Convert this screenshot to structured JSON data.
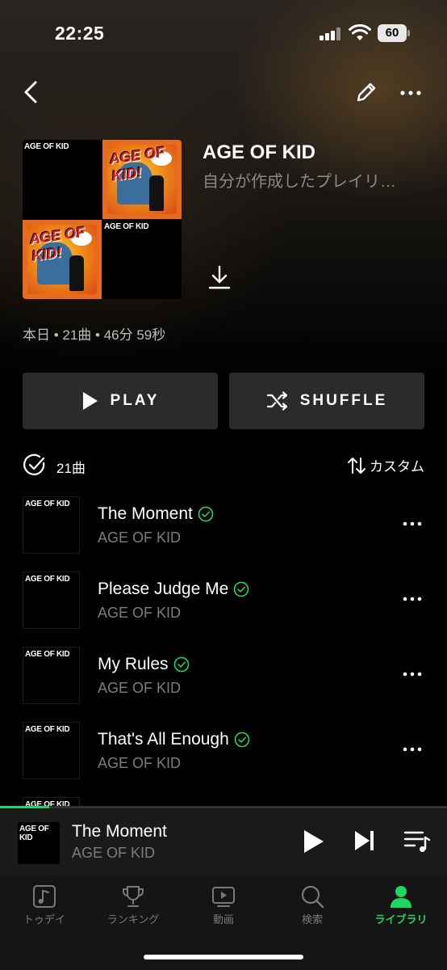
{
  "status": {
    "time": "22:25",
    "battery": "60"
  },
  "playlist": {
    "title": "AGE OF KID",
    "subtitle": "自分が作成したプレイリ…",
    "meta": "本日 • 21曲 • 46分 59秒",
    "art_logo_mini": "AGE OF KID",
    "art_logo_big": "AGE OF KID!"
  },
  "actions": {
    "play": "PLAY",
    "shuffle": "SHUFFLE"
  },
  "list_header": {
    "count": "21曲",
    "sort": "カスタム"
  },
  "tracks": [
    {
      "title": "The Moment",
      "artist": "AGE OF KID"
    },
    {
      "title": "Please Judge Me",
      "artist": "AGE OF KID"
    },
    {
      "title": "My Rules",
      "artist": "AGE OF KID"
    },
    {
      "title": "That's All Enough",
      "artist": "AGE OF KID"
    },
    {
      "title": "",
      "artist": ""
    }
  ],
  "now_playing": {
    "title": "The Moment",
    "artist": "AGE OF KID",
    "progress": 0.11
  },
  "tabs": [
    {
      "label": "トゥデイ",
      "icon": "music-note-icon"
    },
    {
      "label": "ランキング",
      "icon": "trophy-icon"
    },
    {
      "label": "動画",
      "icon": "video-play-icon"
    },
    {
      "label": "検索",
      "icon": "search-icon"
    },
    {
      "label": "ライブラリ",
      "icon": "person-icon",
      "active": true
    }
  ],
  "colors": {
    "accent": "#1ed760",
    "button_bg": "#2b2b2b",
    "secondary_text": "#7d7d7d"
  }
}
